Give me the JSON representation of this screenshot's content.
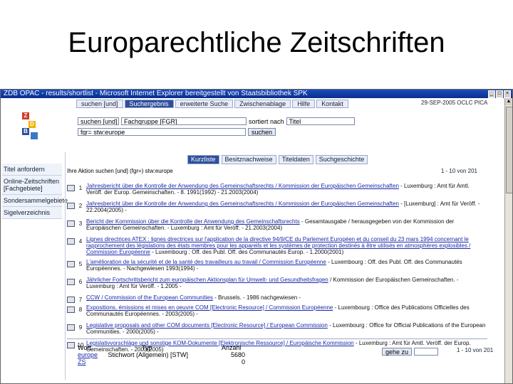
{
  "slide_title": "Europarechtliche Zeitschriften",
  "window": {
    "title": "ZDB OPAC - results/shortlist - Microsoft Internet Explorer bereitgestellt von Staatsbibliothek SPK"
  },
  "top_tabs": [
    "suchen [und]",
    "Suchergebnis",
    "erweiterte Suche",
    "Zwischenablage",
    "Hilfe",
    "Kontakt"
  ],
  "top_tabs_active": 1,
  "date_text": "29-SEP-2005 OCLC PICA",
  "search": {
    "row1_select": "suchen [und]",
    "row1_field_select": "Fachgruppe [FGR]",
    "row1_sort_label": "sortiert nach",
    "row1_sort_select": "Titel",
    "row2_value": "fgr=  stw:europe",
    "row2_button": "suchen"
  },
  "result_tabs": [
    "Kurzliste",
    "Besitznachweise",
    "Titeldaten",
    "Suchgeschichte"
  ],
  "result_tabs_active": 0,
  "nav_items": [
    "Titel anfordern",
    "Online-Zeitschriften [Fachgebiete]",
    "Sondersammelgebiete",
    "Sigelverzeichnis"
  ],
  "action_bar": {
    "text": "Ihre Aktion  suchen [und]  (fgr=) stw:europe",
    "pager": "1 - 10 von 201"
  },
  "results": [
    {
      "num": "1",
      "link": "Jahresbericht über die Kontrolle der Anwendung des Gemeinschaftsrechts / Kommission der Europäischen Gemeinschaften",
      "rest": "- Luxemburg : Amt für Amtl. Veröff. der Europ. Gemeinschaften. - 8. 1991(1992) - 21.2003(2004)"
    },
    {
      "num": "2",
      "link": "Jahresbericht über die Kontrolle der Anwendung des Gemeinschaftsrechts / Kommission der Europäischen Gemeinschaften",
      "rest": "- [Luxemburg] : Amt für Veröff. - 22.2004(2005) -"
    },
    {
      "num": "3",
      "link": "Bericht der Kommission über die Kontrolle der Anwendung des Gemeinschaftsrechts",
      "rest": "- Gesamtausgabe / herausgegeben von der Kommission der Europäischen Gemeinschaften. - Luxemburg : Amt für Veröff. - 21.2003(2004)"
    },
    {
      "num": "4",
      "link": "Lignes directrices ATEX : lignes directrices sur l'application de la directive 94/9/CE du Parlement Européen et du conseil du 23 mars 1994 concernant le rapprochement des législations des états membres pour les appareils et les systèmes de protection destinés à être utilisés en atmosphères explosibles / Commission Européenne",
      "rest": "- Luxembourg : Off. des Publ. Off. des Communautés Europ. - 1.2000(2001)"
    },
    {
      "num": "5",
      "link": "L'amélioration de la sécurité et de la santé des travailleurs au travail / Commission Européenne",
      "rest": "- Luxembourg : Off. des Publ. Off. des Communautés Européennes. - Nachgewiesen 1993(1994) -"
    },
    {
      "num": "6",
      "link": "Jährlicher Fortschrittsbericht zum europäischen Aktionsplan für Umwelt- und Gesundheitsfragen",
      "rest": "/ Kommission der Europäischen Gemeinschaften. - Luxemburg : Amt für Veröff. - 1.2005 -"
    },
    {
      "num": "7",
      "link": "CCW / Commission of the European Communities",
      "rest": "- Brussels. - 1986 nachgewiesen -"
    },
    {
      "num": "8",
      "link": "Expositions, émissions et mises en oeuvre COM [Electronic Resource] / Commission Européenne",
      "rest": "- Luxembourg : Office des Publications Officielles des Communautés Européennes. - 2003(2005) -"
    },
    {
      "num": "9",
      "link": "Legislative proposals and other COM documents [Electronic Resource] / European Commission",
      "rest": "- Luxembourg : Office for Official Publications of the European Communities. - 2000(2005) -"
    },
    {
      "num": "10",
      "link": "Legislativvorschläge und sonstige KOM-Dokumente [Elektronische Ressource] / Europäische Kommission",
      "rest": "- Luxemburg : Amt für Amtl. Veröff. der Europ. Gemeinschaften. - 2003(2005)"
    }
  ],
  "bottom_table": {
    "headers": [
      "Wort",
      "Typ",
      "Anzahl"
    ],
    "rows": [
      [
        "europe",
        "Stichwort (Allgemein) [STW]",
        "5680"
      ],
      [
        "ZS",
        "",
        "0"
      ]
    ],
    "goto_label": "gehe zu",
    "pager": "1 - 10 von 201"
  },
  "colors": {
    "accent": "#2d4f9d",
    "link": "#1a2aa8",
    "titlebar": "#1b4dbd"
  }
}
